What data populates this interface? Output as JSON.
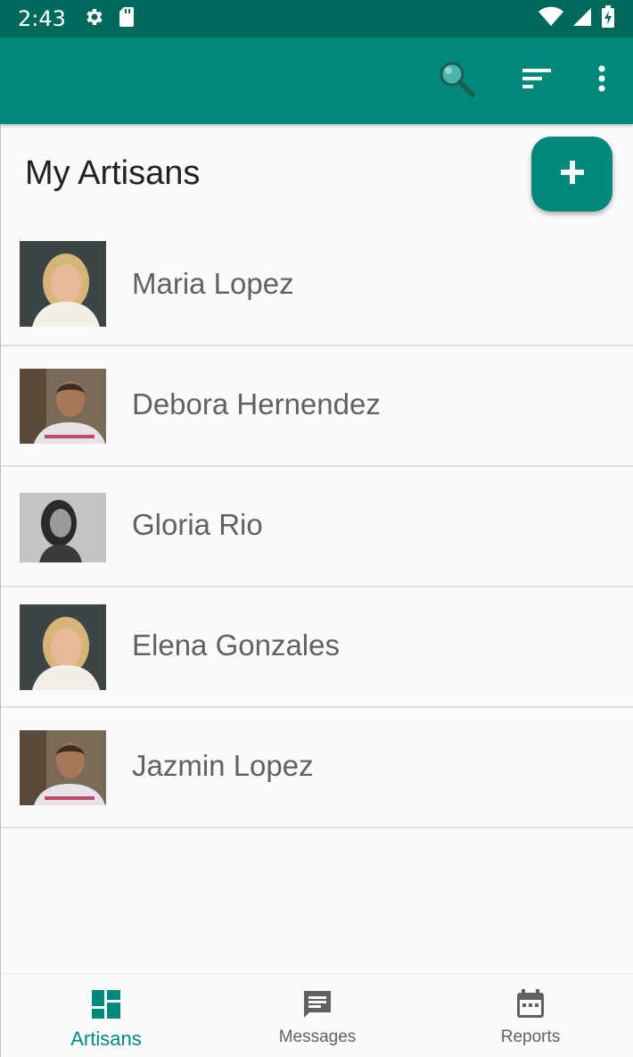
{
  "status_bar": {
    "time": "2:43",
    "icons": [
      "gear-icon",
      "sd-card-icon",
      "wifi-icon",
      "signal-icon",
      "battery-charging-icon"
    ]
  },
  "app_bar": {
    "actions": [
      "search-icon",
      "sort-icon",
      "more-vert-icon"
    ],
    "background": "#00897b"
  },
  "header": {
    "title": "My Artisans",
    "fab_icon": "plus-icon"
  },
  "artisans": [
    {
      "name": "Maria Lopez"
    },
    {
      "name": "Debora Hernendez"
    },
    {
      "name": "Gloria Rio"
    },
    {
      "name": "Elena Gonzales"
    },
    {
      "name": "Jazmin Lopez"
    }
  ],
  "bottom_nav": {
    "items": [
      {
        "label": "Artisans",
        "icon": "dashboard-icon",
        "active": true
      },
      {
        "label": "Messages",
        "icon": "message-icon",
        "active": false
      },
      {
        "label": "Reports",
        "icon": "calendar-icon",
        "active": false
      }
    ]
  },
  "colors": {
    "primary": "#00897b",
    "primary_dark": "#00695c",
    "active_nav": "#00897b",
    "inactive_nav": "#616161"
  }
}
